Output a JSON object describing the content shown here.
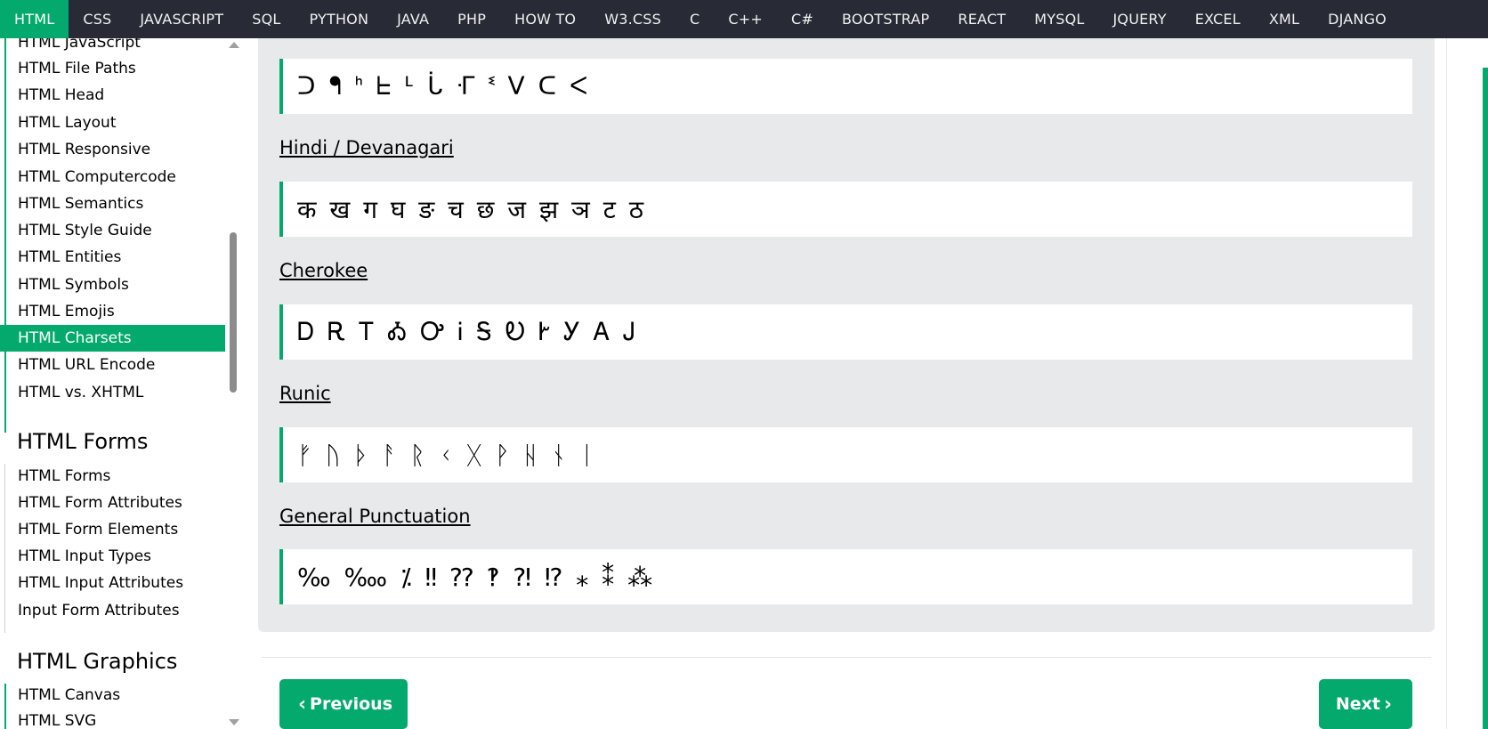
{
  "topnav": {
    "items": [
      "HTML",
      "CSS",
      "JAVASCRIPT",
      "SQL",
      "PYTHON",
      "JAVA",
      "PHP",
      "HOW TO",
      "W3.CSS",
      "C",
      "C++",
      "C#",
      "BOOTSTRAP",
      "REACT",
      "MYSQL",
      "JQUERY",
      "EXCEL",
      "XML",
      "DJANGO"
    ],
    "active_index": 0
  },
  "sidebar": {
    "items_top": [
      "HTML JavaScript",
      "HTML File Paths",
      "HTML Head",
      "HTML Layout",
      "HTML Responsive",
      "HTML Computercode",
      "HTML Semantics",
      "HTML Style Guide",
      "HTML Entities",
      "HTML Symbols",
      "HTML Emojis",
      "HTML Charsets",
      "HTML URL Encode",
      "HTML vs. XHTML"
    ],
    "active_item": "HTML Charsets",
    "forms_heading": "HTML Forms",
    "forms_items": [
      "HTML Forms",
      "HTML Form Attributes",
      "HTML Form Elements",
      "HTML Input Types",
      "HTML Input Attributes",
      "Input Form Attributes"
    ],
    "graphics_heading": "HTML Graphics",
    "graphics_items": [
      "HTML Canvas",
      "HTML SVG"
    ]
  },
  "main": {
    "sections": [
      {
        "title": "",
        "chars": "ᑐ ᖳ ᑋ ᖶ ᒻ ᒑ ᒮ ᓫ ᐯ ᑕ ᐸ"
      },
      {
        "title": "Hindi / Devanagari",
        "chars": "क ख ग घ ङ च छ ज झ ञ ट ठ"
      },
      {
        "title": "Cherokee",
        "chars": "Ꭰ Ꭱ Ꭲ Ꭳ Ꭴ Ꭵ Ꭶ Ꭷ Ꭸ Ꭹ Ꭺ Ꭻ"
      },
      {
        "title": "Runic",
        "chars": "ᚠ ᚢ ᚦ ᚨ ᚱ ᚲ ᚷ ᚹ ᚺ ᚾ ᛁ"
      },
      {
        "title": "General Punctuation",
        "chars": "‰ ‱ ⁒ ‼ ⁇ ‽ ⁈ ⁉ ⁎ ⁑ ⁂"
      }
    ],
    "prev_label": "Previous",
    "next_label": "Next"
  },
  "colors": {
    "accent": "#04aa6d",
    "nav_bg": "#282a35",
    "panel_bg": "#e7e9eb"
  }
}
